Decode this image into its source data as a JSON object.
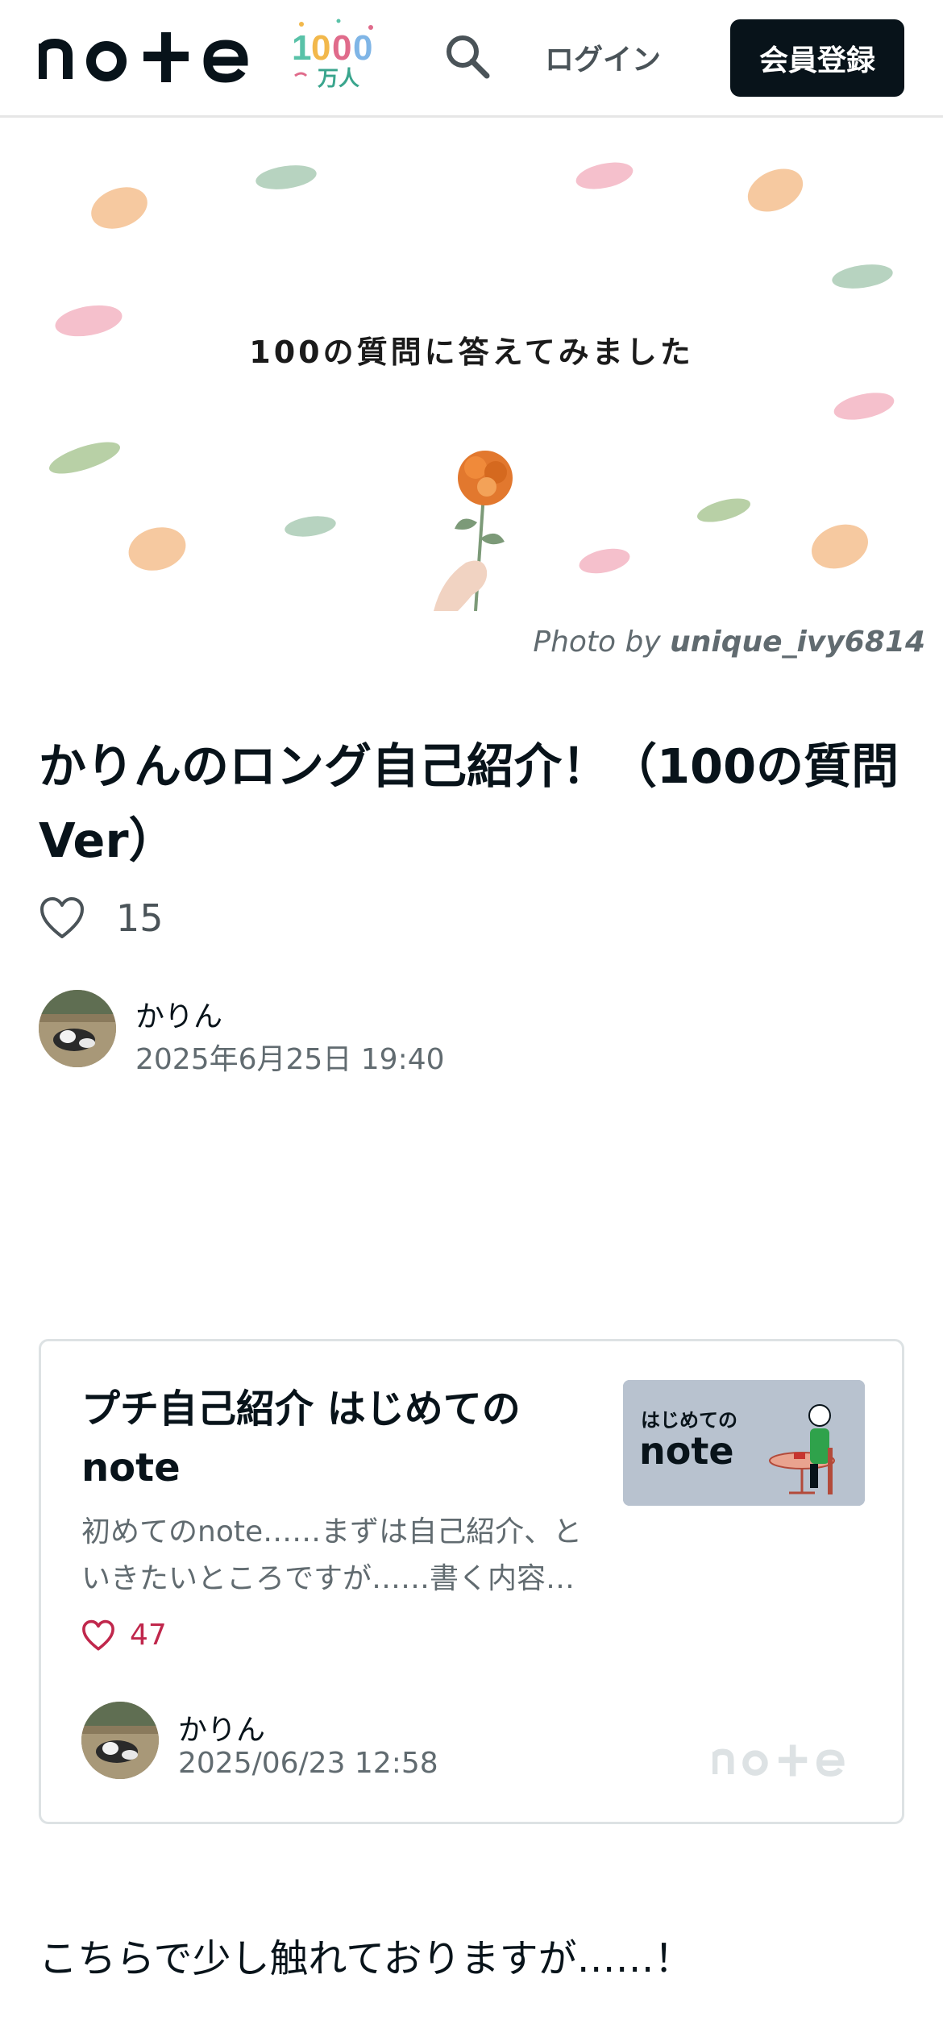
{
  "header": {
    "logo_text": "note",
    "badge_number": "1000",
    "badge_unit": "万人",
    "search_icon": "search-icon",
    "login_label": "ログイン",
    "signup_label": "会員登録"
  },
  "hero": {
    "image_text": "100の質問に答えてみました",
    "credit_prefix": "Photo by",
    "credit_user": "unique_ivy6814"
  },
  "article": {
    "title": "かりんのロング自己紹介！（100の質問Ver）",
    "like_icon": "heart-icon",
    "like_count": "15",
    "author_name": "かりん",
    "published": "2025年6月25日 19:40"
  },
  "embed_card": {
    "title": "プチ自己紹介 はじめてのnote",
    "thumb_line1": "はじめての",
    "thumb_line2": "note",
    "description": "初めてのnote……まずは自己紹介、といきたいところですが……書く内容…",
    "like_count": "47",
    "author_name": "かりん",
    "date": "2025/06/23 12:58",
    "logo_text": "note"
  },
  "body": {
    "first_paragraph": "こちらで少し触れておりますが……！"
  },
  "colors": {
    "primary": "#08131a",
    "accent_like": "#c0274c",
    "muted": "#616b70"
  }
}
